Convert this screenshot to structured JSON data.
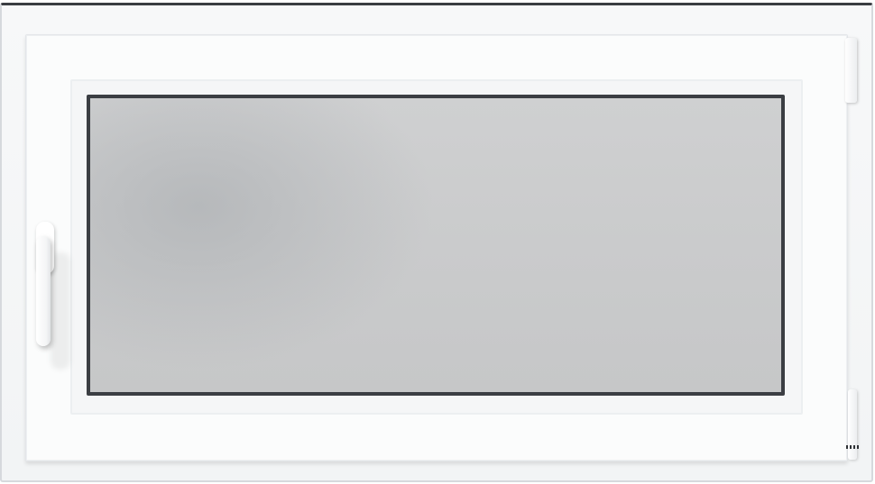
{
  "scene": {
    "subject": "window",
    "colors": {
      "frame": "#f7f8f9",
      "glass": "#cacbcc",
      "gasket": "#3b3e43",
      "handle": "#ffffff"
    },
    "icons": [
      "window-handle-icon",
      "hinge-icon"
    ]
  }
}
